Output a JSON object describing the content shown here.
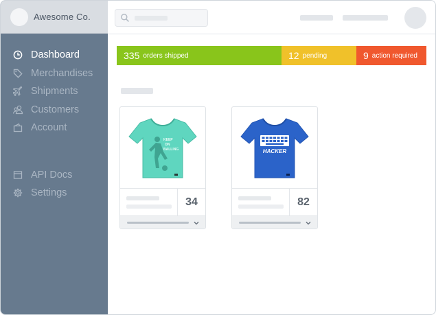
{
  "sidebar": {
    "brand_name": "Awesome Co.",
    "items": [
      {
        "label": "Dashboard",
        "icon": "clock-icon"
      },
      {
        "label": "Merchandises",
        "icon": "tag-icon"
      },
      {
        "label": "Shipments",
        "icon": "plane-icon"
      },
      {
        "label": "Customers",
        "icon": "users-icon"
      },
      {
        "label": "Account",
        "icon": "wallet-icon"
      },
      {
        "label": "API Docs",
        "icon": "window-icon"
      },
      {
        "label": "Settings",
        "icon": "gear-icon"
      }
    ],
    "active": "Dashboard"
  },
  "status": {
    "shipped": {
      "count": "335",
      "label": "orders shipped",
      "color": "#89c51b"
    },
    "pending": {
      "count": "12",
      "label": "pending",
      "color": "#f0c12a"
    },
    "action": {
      "count": "9",
      "label": "action required",
      "color": "#f0582e"
    }
  },
  "products": [
    {
      "image": "mint-tshirt-with-figure-print",
      "count": "34"
    },
    {
      "image": "blue-tshirt-hacker-keyboard-print",
      "count": "82",
      "print_text": "HACKER"
    }
  ]
}
